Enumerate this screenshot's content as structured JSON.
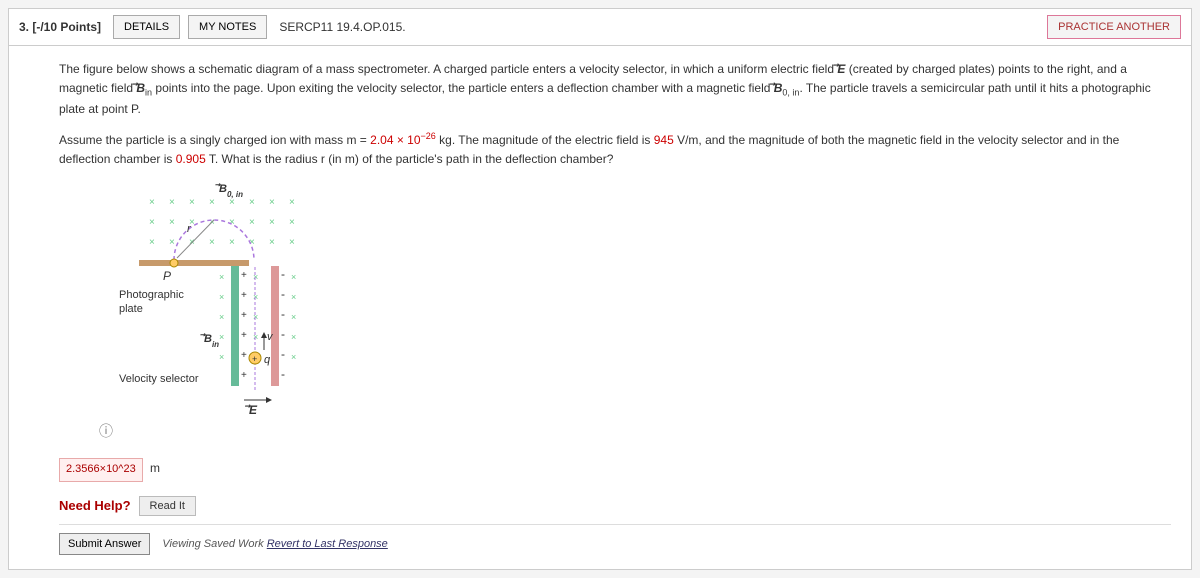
{
  "header": {
    "qnum": "3. [-/10 Points]",
    "details": "DETAILS",
    "mynotes": "MY NOTES",
    "problem_id": "SERCP11 19.4.OP.015.",
    "practice": "PRACTICE ANOTHER"
  },
  "prompt": {
    "p1a": "The figure below shows a schematic diagram of a mass spectrometer. A charged particle enters a velocity selector, in which a uniform electric field ",
    "E": "E",
    "p1b": " (created by charged plates) points to the right, and a magnetic field ",
    "Bin": "B",
    "Bin_sub": "in",
    "p1c": " points into the page. Upon exiting the velocity selector, the particle enters a deflection chamber with a magnetic field ",
    "B0": "B",
    "B0_sub": "0, in",
    "p1d": ". The particle travels a semicircular path until it hits a photographic plate at point P.",
    "p2a": "Assume the particle is a singly charged ion with mass m = ",
    "mass": "2.04 × 10",
    "mass_exp": "−26",
    "p2b": " kg. The magnitude of the electric field is ",
    "efield": "945",
    "p2c": " V/m, and the magnitude of both the magnetic field in the velocity selector and in the deflection chamber is ",
    "bfield": "0.905",
    "p2d": " T. What is the radius r (in m) of the particle's path in the deflection chamber?"
  },
  "diagram": {
    "b0_label": "B",
    "b0_sub": "0, in",
    "P": "P",
    "photoplate": "Photographic plate",
    "bin_label": "B",
    "bin_sub": "in",
    "velsel": "Velocity selector",
    "E_label": "E",
    "v_label": "v",
    "q_label": "q"
  },
  "answer": {
    "value": "2.3566×10^23",
    "unit": "m"
  },
  "help": {
    "label": "Need Help?",
    "readit": "Read It"
  },
  "footer": {
    "submit": "Submit Answer",
    "saved_a": "Viewing Saved Work ",
    "saved_link": "Revert to Last Response"
  },
  "info_icon": "ⓘ"
}
